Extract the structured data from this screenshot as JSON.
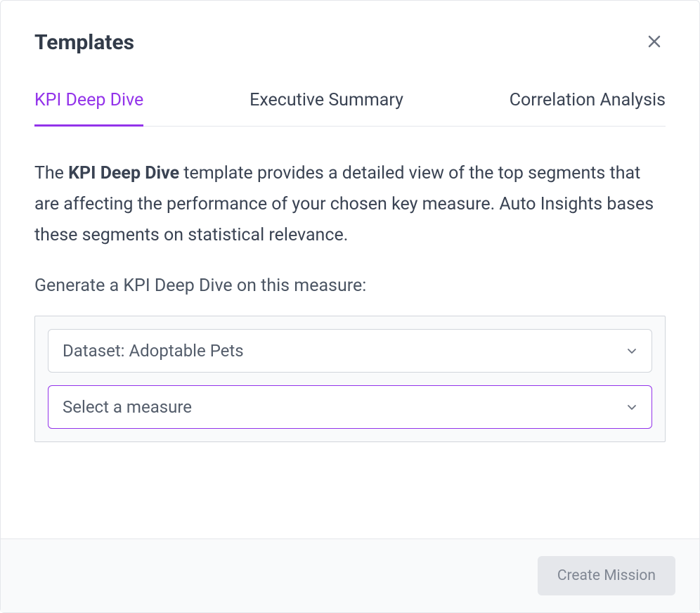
{
  "header": {
    "title": "Templates"
  },
  "tabs": [
    {
      "label": "KPI Deep Dive",
      "active": true
    },
    {
      "label": "Executive Summary",
      "active": false
    },
    {
      "label": "Correlation Analysis",
      "active": false
    }
  ],
  "body": {
    "description_prefix": "The ",
    "description_bold": "KPI Deep Dive",
    "description_suffix": " template provides a detailed view of the top segments that are affecting the performance of your chosen key measure. Auto Insights bases these segments on statistical relevance.",
    "prompt_label": "Generate a KPI Deep Dive on this measure:",
    "dataset_select": "Dataset: Adoptable Pets",
    "measure_select": "Select a measure"
  },
  "footer": {
    "create_label": "Create Mission"
  }
}
